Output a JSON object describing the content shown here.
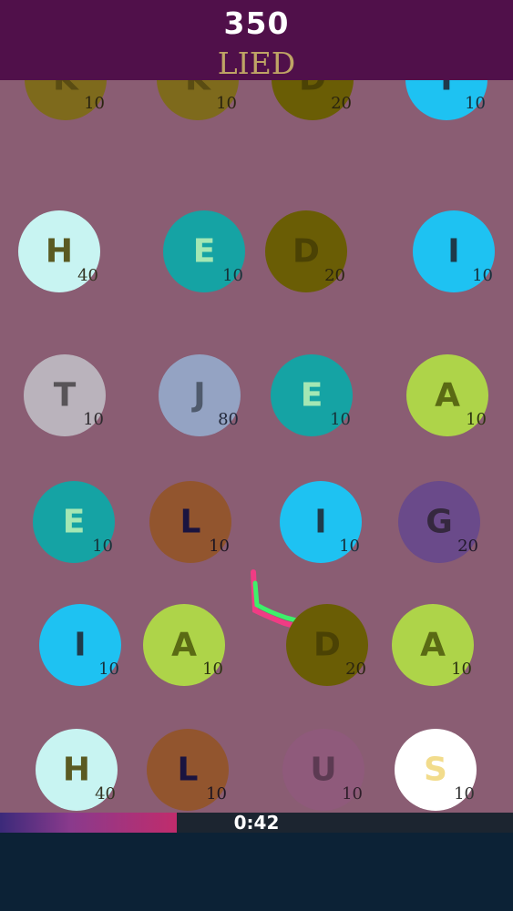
{
  "header": {
    "score": "350",
    "current_word": "LIED"
  },
  "timer": {
    "label": "0:42",
    "remaining_fraction": 0.345
  },
  "colors": {
    "header_bg": "#50104a",
    "board_bg": "#8a5d73",
    "word_text": "#bfa465",
    "footer_bg": "#0c2236"
  },
  "tiles": [
    {
      "letter": "K",
      "points": "10",
      "fill": "#7e6a1c",
      "text": "#5a4c12",
      "pts": "#2a2410"
    },
    {
      "letter": "K",
      "points": "10",
      "fill": "#7e6a1c",
      "text": "#5a4c12",
      "pts": "#2a2410"
    },
    {
      "letter": "D",
      "points": "20",
      "fill": "#6a5d05",
      "text": "#4b4204",
      "pts": "#2a2410"
    },
    {
      "letter": "I",
      "points": "10",
      "fill": "#1ec2f2",
      "text": "#1f3a4a",
      "pts": "#16303c"
    },
    {
      "letter": "H",
      "points": "40",
      "fill": "#c8f4f2",
      "text": "#5a5a22",
      "pts": "#333322"
    },
    {
      "letter": "E",
      "points": "10",
      "fill": "#15a3a4",
      "text": "#a4e7b4",
      "pts": "#17333a"
    },
    {
      "letter": "D",
      "points": "20",
      "fill": "#6a5d05",
      "text": "#4b4204",
      "pts": "#2a2410"
    },
    {
      "letter": "I",
      "points": "10",
      "fill": "#1ec2f2",
      "text": "#1f3a4a",
      "pts": "#16303c"
    },
    {
      "letter": "T",
      "points": "10",
      "fill": "#bab3bc",
      "text": "#585458",
      "pts": "#2e2a2e"
    },
    {
      "letter": "J",
      "points": "80",
      "fill": "#94a3c3",
      "text": "#4f5a6c",
      "pts": "#22283a"
    },
    {
      "letter": "E",
      "points": "10",
      "fill": "#15a3a4",
      "text": "#a4e7b4",
      "pts": "#17333a"
    },
    {
      "letter": "A",
      "points": "10",
      "fill": "#aed449",
      "text": "#5a6a14",
      "pts": "#2c3410"
    },
    {
      "letter": "E",
      "points": "10",
      "fill": "#15a3a4",
      "text": "#a4e7b4",
      "pts": "#17333a"
    },
    {
      "letter": "L",
      "points": "10",
      "fill": "#92552e",
      "text": "#1a1440",
      "pts": "#1e1622"
    },
    {
      "letter": "I",
      "points": "10",
      "fill": "#1ec2f2",
      "text": "#1f3a4a",
      "pts": "#16303c"
    },
    {
      "letter": "G",
      "points": "20",
      "fill": "#6a4a8a",
      "text": "#35283f",
      "pts": "#20182a"
    },
    {
      "letter": "I",
      "points": "10",
      "fill": "#1ec2f2",
      "text": "#1f3a4a",
      "pts": "#16303c"
    },
    {
      "letter": "A",
      "points": "10",
      "fill": "#aed449",
      "text": "#5a6a14",
      "pts": "#2c3410"
    },
    {
      "letter": "D",
      "points": "20",
      "fill": "#6a5d05",
      "text": "#4b4204",
      "pts": "#2a2410"
    },
    {
      "letter": "A",
      "points": "10",
      "fill": "#aed449",
      "text": "#5a6a14",
      "pts": "#2c3410"
    },
    {
      "letter": "H",
      "points": "40",
      "fill": "#c8f4f2",
      "text": "#5a5a22",
      "pts": "#333322"
    },
    {
      "letter": "L",
      "points": "10",
      "fill": "#92552e",
      "text": "#1a1440",
      "pts": "#1e1622"
    },
    {
      "letter": "U",
      "points": "10",
      "fill": "#8f5a7b",
      "text": "#5c3a52",
      "pts": "#2e1e2a"
    },
    {
      "letter": "S",
      "points": "10",
      "fill": "#ffffff",
      "text": "#f2dc8c",
      "pts": "#333333"
    }
  ]
}
